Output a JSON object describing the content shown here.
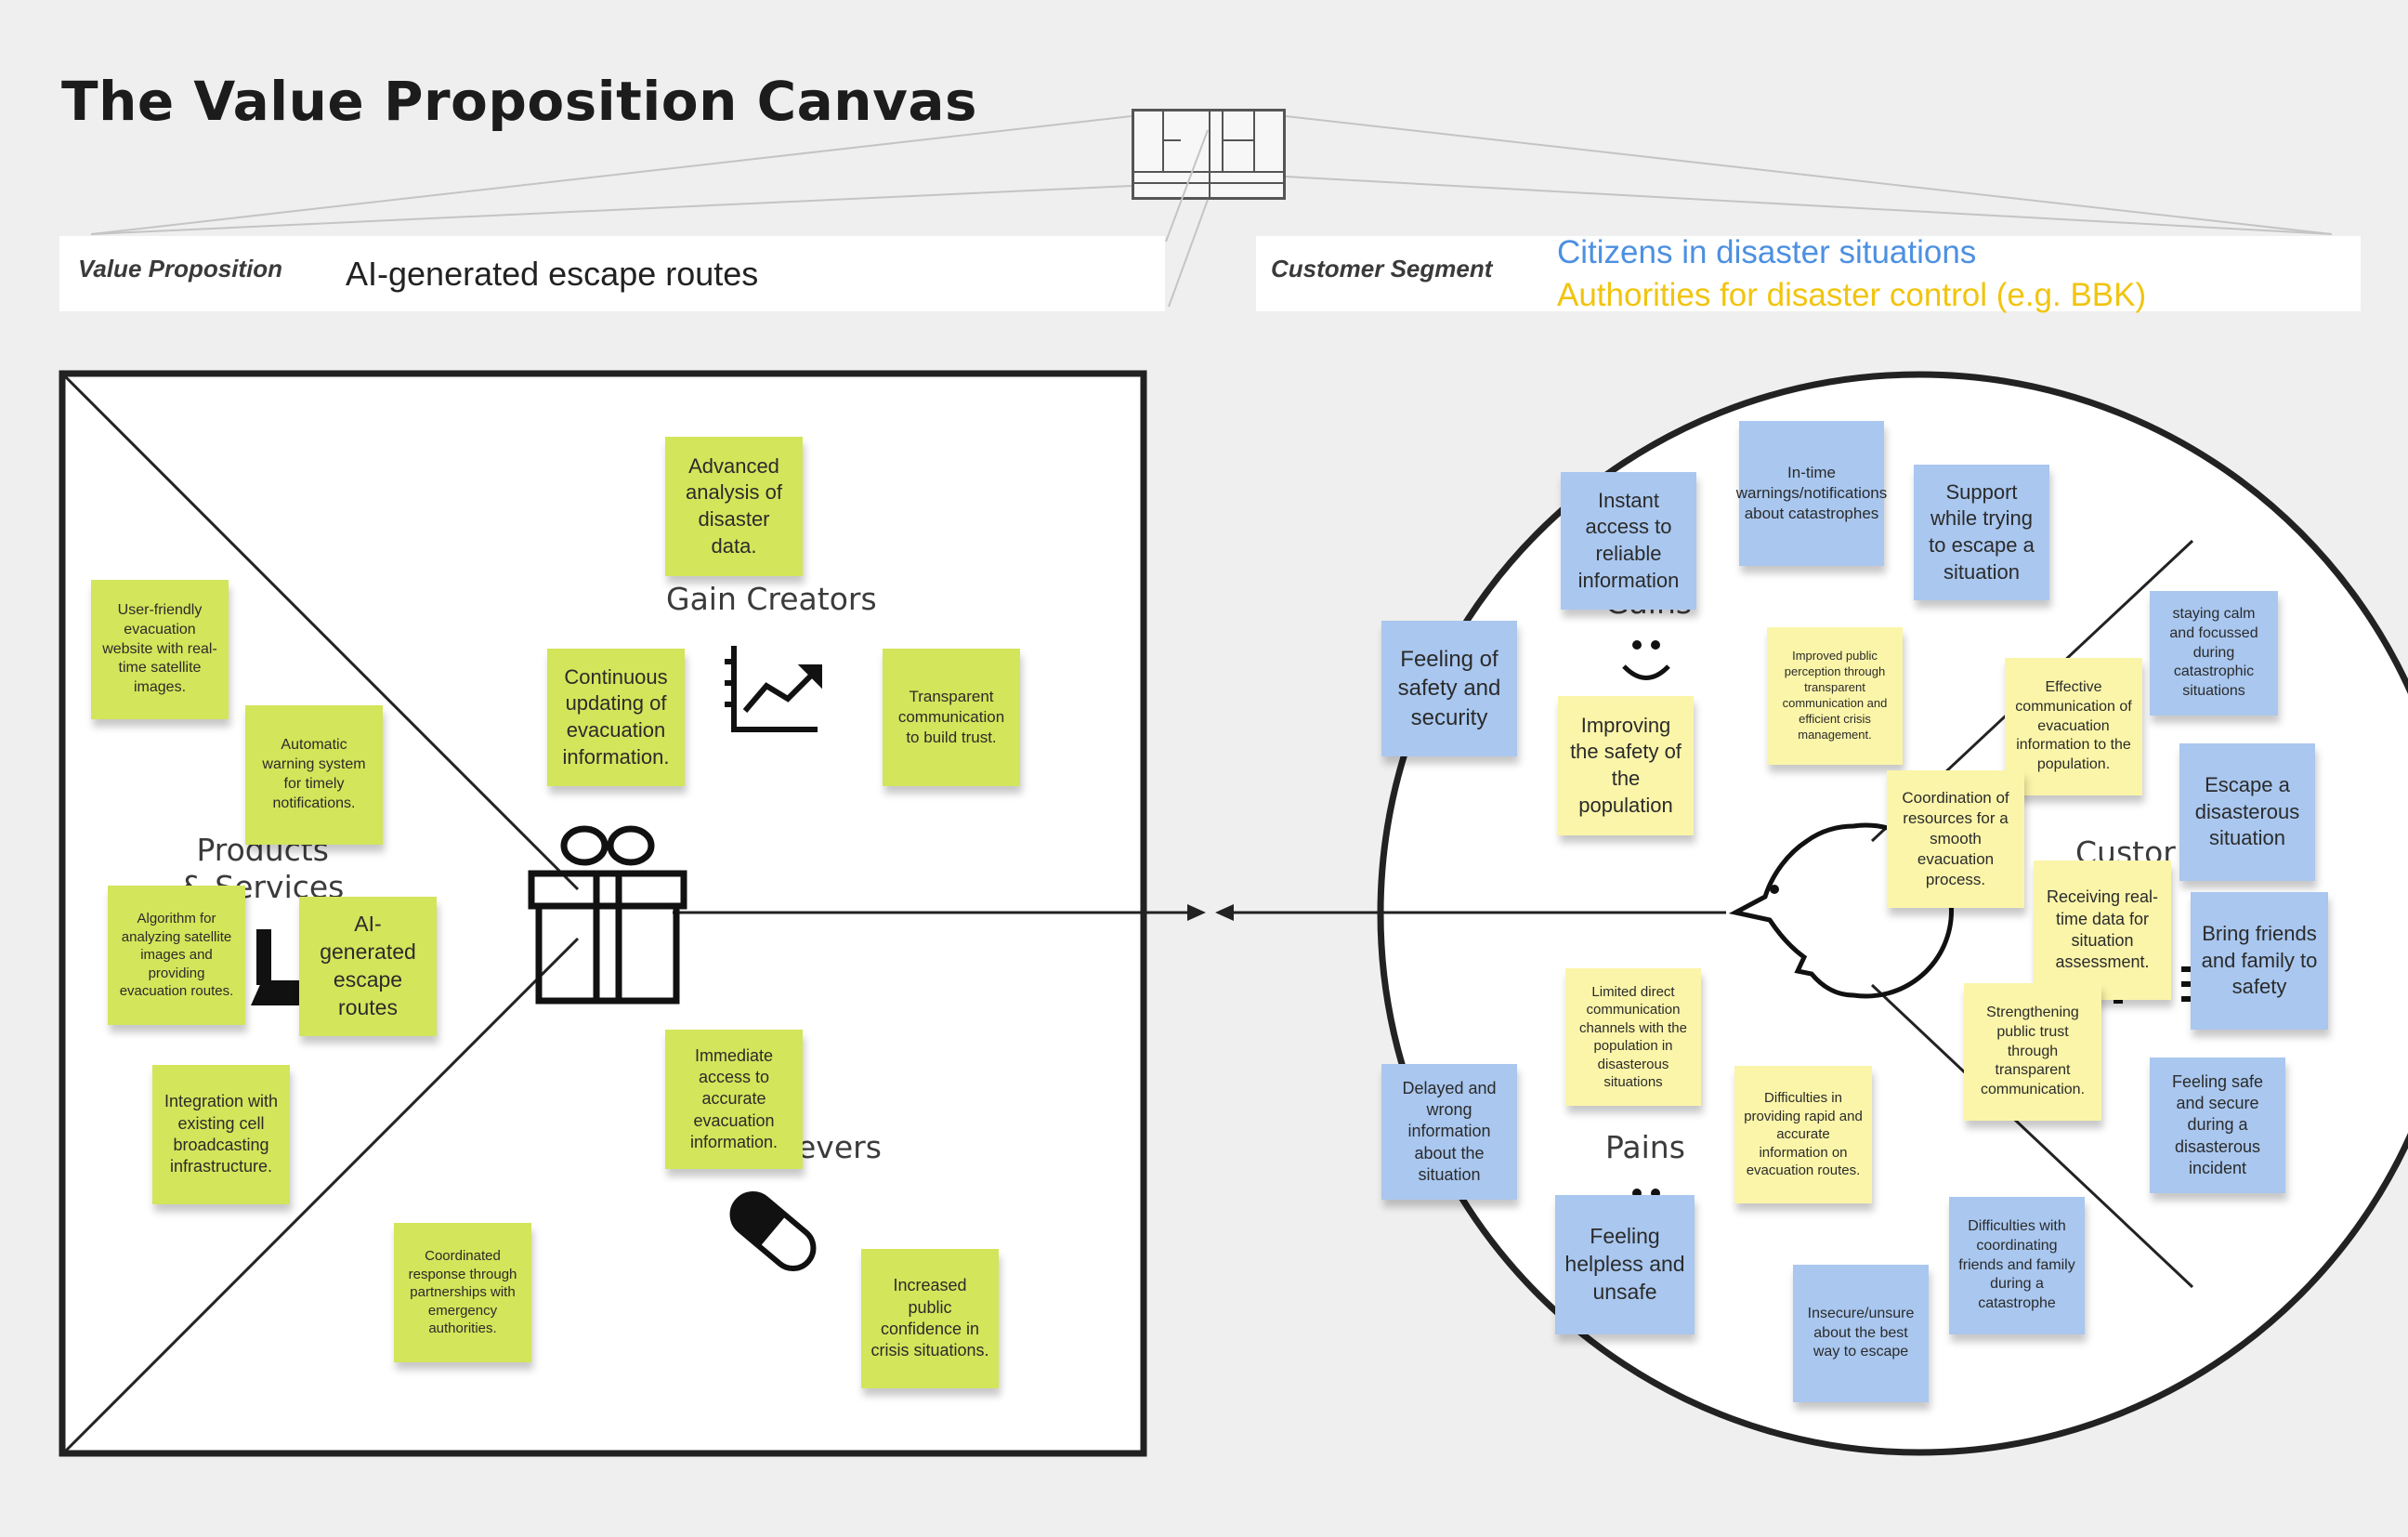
{
  "title": "The Value Proposition Canvas",
  "value_proposition": {
    "label": "Value Proposition",
    "value": "AI-generated escape routes"
  },
  "customer_segment": {
    "label": "Customer Segment",
    "values": [
      "Citizens in disaster situations",
      "Authorities for disaster control (e.g. BBK)"
    ],
    "colors": [
      "#4d90e0",
      "#f1c40f"
    ]
  },
  "section_labels": {
    "gain_creators": "Gain Creators",
    "products_services": "Products\n& Services",
    "pain_relievers": "evers",
    "gains": "Gains",
    "pains": "Pains",
    "customer_jobs": "Custor\ns)"
  },
  "icons": [
    "gift-icon",
    "chart-icon",
    "pill-icon",
    "product-icon",
    "face-icon",
    "smile-icon",
    "frown-icon",
    "list-icon"
  ],
  "note_colors": {
    "green": "#d3e55a",
    "blue": "#a9c7ef",
    "yellow": "#fbf5a9"
  },
  "notes": {
    "advanced_analysis": "Advanced analysis of disaster data.",
    "continuous_updating": "Continuous updating of evacuation information.",
    "transparent_communication": "Transparent communication to build trust.",
    "user_friendly_website": "User-friendly evacuation website with real-time satellite images.",
    "automatic_warning": "Automatic warning system for timely notifications.",
    "algorithm": "Algorithm for analyzing satellite images and providing evacuation routes.",
    "ai_routes": "AI-generated escape routes",
    "integration": "Integration with existing cell broadcasting infrastructure.",
    "coordinated_response": "Coordinated response through partnerships with emergency authorities.",
    "immediate_access": "Immediate access to accurate evacuation information.",
    "increased_confidence": "Increased public confidence in crisis situations.",
    "instant_access": "Instant access to reliable information",
    "in_time_warnings": "In-time warnings/notifications about catastrophes",
    "support_escape": "Support while trying to escape a situation",
    "feeling_safety": "Feeling of safety and security",
    "improving_safety": "Improving the safety of the population",
    "improved_perception": "Improved public perception through transparent communication and efficient crisis management.",
    "effective_communication": "Effective communication of evacuation information to the population.",
    "coordination_resources": "Coordination of resources for a smooth evacuation process.",
    "staying_calm": "staying calm and focussed during catastrophic situations",
    "escape_disaster": "Escape a disasterous situation",
    "receiving_data": "Receiving real-time data for situation assessment.",
    "bring_friends": "Bring friends and family to safety",
    "strengthening_trust": "Strengthening public trust through transparent communication.",
    "feeling_safe": "Feeling safe and secure during a disasterous incident",
    "limited_channels": "Limited direct communication channels with the population in disasterous situations",
    "delayed_info": "Delayed and wrong information about the situation",
    "difficulties_rapid": "Difficulties in providing rapid and accurate information on evacuation routes.",
    "feeling_helpless": "Feeling helpless and unsafe",
    "insecure_escape": "Insecure/unsure about the best way to escape",
    "difficulties_coordinating": "Difficulties with coordinating friends and family during a catastrophe"
  }
}
